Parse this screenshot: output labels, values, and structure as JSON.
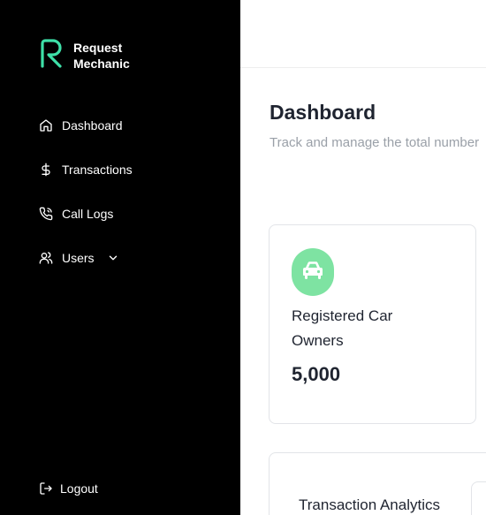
{
  "brand": {
    "line1": "Request",
    "line2": "Mechanic",
    "accent": "#3ee0a8"
  },
  "sidebar": {
    "items": [
      {
        "label": "Dashboard",
        "icon": "home-icon"
      },
      {
        "label": "Transactions",
        "icon": "dollar-icon"
      },
      {
        "label": "Call Logs",
        "icon": "phone-icon"
      },
      {
        "label": "Users",
        "icon": "users-icon",
        "has_dropdown": true
      }
    ],
    "logout_label": "Logout"
  },
  "header": {
    "title": "Dashboard",
    "subtitle": "Track and manage the total number"
  },
  "stat_card": {
    "label": "Registered Car Owners",
    "value": "5,000",
    "icon": "car-icon",
    "badge_color": "#7ee3a2"
  },
  "analytics": {
    "title": "Transaction Analytics"
  }
}
